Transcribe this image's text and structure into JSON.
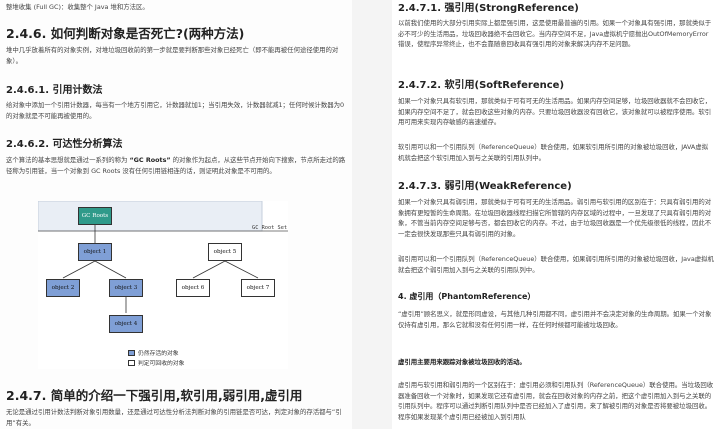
{
  "left": {
    "top_line": "整堆收集 (Full GC)：收集整个 Java 堆和方法区。",
    "h246": "2.4.6. 如何判断对象是否死亡?(两种方法)",
    "p1": "堆中几乎放着所有的对象实例，对堆垃圾回收前的第一步就是要判断那些对象已经死亡（即不能再被任何途径使用的对象）。",
    "h2461": "2.4.6.1. 引用计数法",
    "p2": "给对象中添加一个引用计数器，每当有一个地方引用它，计数器就加1；当引用失效，计数器就减1；任何时候计数器为0的对象就是不可能再被使用的。",
    "h2462": "2.4.6.2. 可达性分析算法",
    "p3a": "这个算法的基本思想就是通过一系列的称为 ",
    "p3b": "“GC Roots”",
    "p3c": " 的对象作为起点，从这些节点开始向下搜索，节点所走过的路径称为引用链，当一个对象到 GC Roots 没有任何引用链相连的话，则证明此对象是不可用的。",
    "diagram": {
      "root": "GC Roots",
      "set_label": "GC Root Set",
      "o1": "object 1",
      "o2": "object 2",
      "o3": "object 3",
      "o4": "object 4",
      "o5": "object 5",
      "o6": "object 6",
      "o7": "object 7",
      "legend_alive": "仍然存活的对象",
      "legend_dead": "判定可回收的对象"
    },
    "h247": "2.4.7. 简单的介绍一下强引用,软引用,弱引用,虚引用",
    "p4": "无论是通过引用计数法判断对象引用数量，还是通过可达性分析法判断对象的引用链是否可达，判定对象的存活都与“引用”有关。"
  },
  "right": {
    "h2471": "2.4.7.1. 强引用(StrongReference)",
    "p1": "以前我们使用的大部分引用实际上都是强引用，这是使用最普遍的引用。如果一个对象具有强引用，那就类似于必不可少的生活用品，垃圾回收器绝不会回收它。当内存空间不足，Java虚拟机宁愿抛出OutOfMemoryError错误，使程序异常终止，也不会靠随意回收具有强引用的对象来解决内存不足问题。",
    "h2472": "2.4.7.2. 软引用(SoftReference)",
    "p2": "如果一个对象只具有软引用，那就类似于可有可无的生活用品。如果内存空间足够，垃圾回收器就不会回收它，如果内存空间不足了，就会回收这些对象的内存。只要垃圾回收器没有回收它，该对象就可以被程序使用。软引用可用来实现内存敏感的高速缓存。",
    "p3": "软引用可以和一个引用队列（ReferenceQueue）联合使用，如果软引用所引用的对象被垃圾回收，JAVA虚拟机就会把这个软引用加入到与之关联的引用队列中。",
    "h2473": "2.4.7.3. 弱引用(WeakReference)",
    "p4": "如果一个对象只具有弱引用，那就类似于可有可无的生活用品。弱引用与软引用的区别在于：只具有弱引用的对象拥有更短暂的生命周期。在垃圾回收器线程扫描它所管辖的内存区域的过程中，一旦发现了只具有弱引用的对象，不管当前内存空间足够与否，都会回收它的内存。不过，由于垃圾回收器是一个优先级很低的线程，因此不一定会很快发现那些只具有弱引用的对象。",
    "p5": "弱引用可以和一个引用队列（ReferenceQueue）联合使用，如果弱引用所引用的对象被垃圾回收，Java虚拟机就会把这个弱引用加入到与之关联的引用队列中。",
    "h4": "4. 虚引用（PhantomReference）",
    "p6": "“虚引用”顾名思义，就是形同虚设，与其他几种引用都不同，虚引用并不会决定对象的生命周期。如果一个对象仅持有虚引用，那么它就和没有任何引用一样，在任何时候都可能被垃圾回收。",
    "p7": "虚引用主要用来跟踪对象被垃圾回收的活动。",
    "p8": "虚引用与软引用和弱引用的一个区别在于：虚引用必须和引用队列（ReferenceQueue）联合使用。当垃圾回收器准备回收一个对象时，如果发现它还有虚引用，就会在回收对象的内存之前，把这个虚引用加入到与之关联的引用队列中。程序可以通过判断引用队列中是否已经加入了虚引用，来了解被引用的对象是否将要被垃圾回收。程序如果发现某个虚引用已经被加入到引用队"
  }
}
